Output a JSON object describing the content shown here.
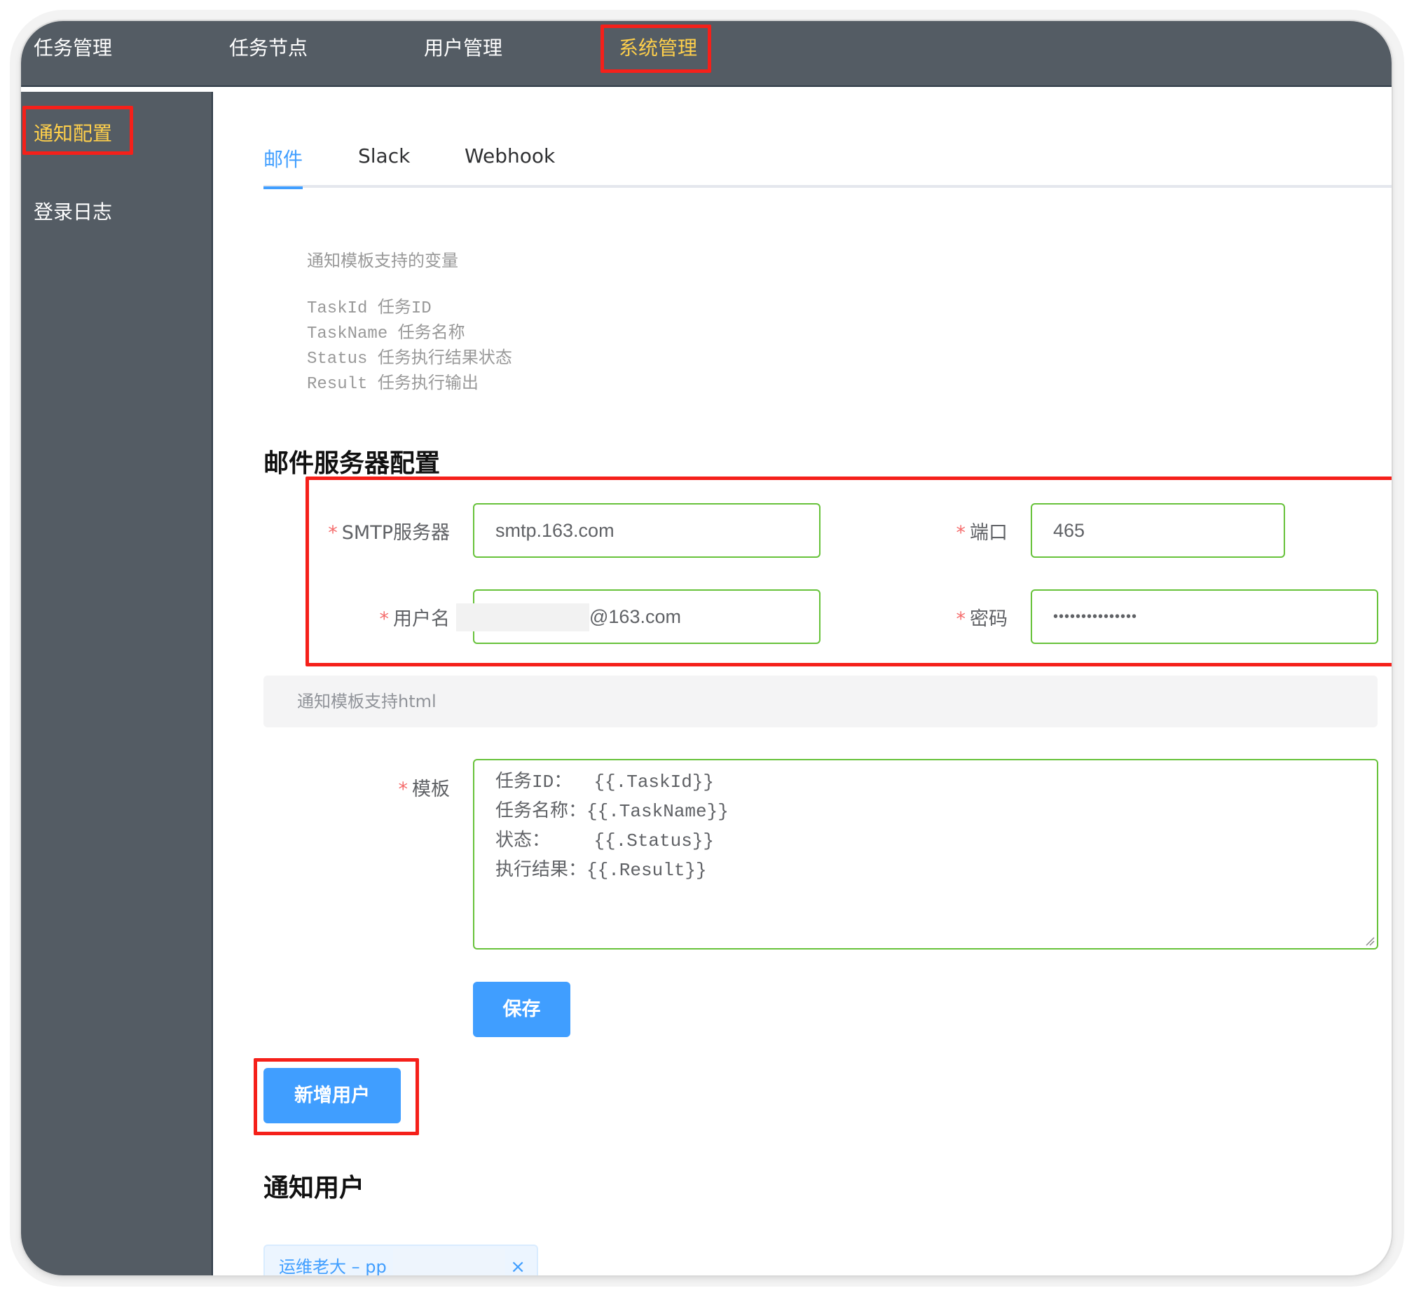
{
  "topnav": {
    "items": [
      {
        "label": "任务管理",
        "active": false
      },
      {
        "label": "任务节点",
        "active": false
      },
      {
        "label": "用户管理",
        "active": false
      },
      {
        "label": "系统管理",
        "active": true
      }
    ]
  },
  "sidebar": {
    "items": [
      {
        "label": "通知配置",
        "active": true
      },
      {
        "label": "登录日志",
        "active": false
      }
    ]
  },
  "tabs": [
    {
      "label": "邮件",
      "active": true
    },
    {
      "label": "Slack",
      "active": false
    },
    {
      "label": "Webhook",
      "active": false
    }
  ],
  "variables": {
    "title": "通知模板支持的变量",
    "lines": [
      "TaskId 任务ID",
      "TaskName 任务名称",
      "Status 任务执行结果状态",
      "Result 任务执行输出"
    ]
  },
  "mail_server": {
    "title": "邮件服务器配置",
    "smtp_label": "SMTP服务器",
    "smtp_value": "smtp.163.com",
    "port_label": "端口",
    "port_value": "465",
    "username_label": "用户名",
    "username_value": "@163.com",
    "password_label": "密码",
    "password_value": "•••••••••••••••",
    "required_mark": "*"
  },
  "template": {
    "tip": "通知模板支持html",
    "label": "模板",
    "lines": [
      "任务ID：  {{.TaskId}}",
      "任务名称：{{.TaskName}}",
      "状态：    {{.Status}}",
      "执行结果：{{.Result}}"
    ]
  },
  "buttons": {
    "save": "保存",
    "add_user": "新增用户"
  },
  "notify_users": {
    "title": "通知用户",
    "tags": [
      {
        "label": "运维老大 – pp",
        "close": "×"
      }
    ]
  },
  "colors": {
    "nav_bg": "#545c64",
    "nav_active": "#ffd04b",
    "primary": "#409eff",
    "valid_border": "#67c23a",
    "required": "#f56c6c",
    "annotation": "#f5201a"
  }
}
